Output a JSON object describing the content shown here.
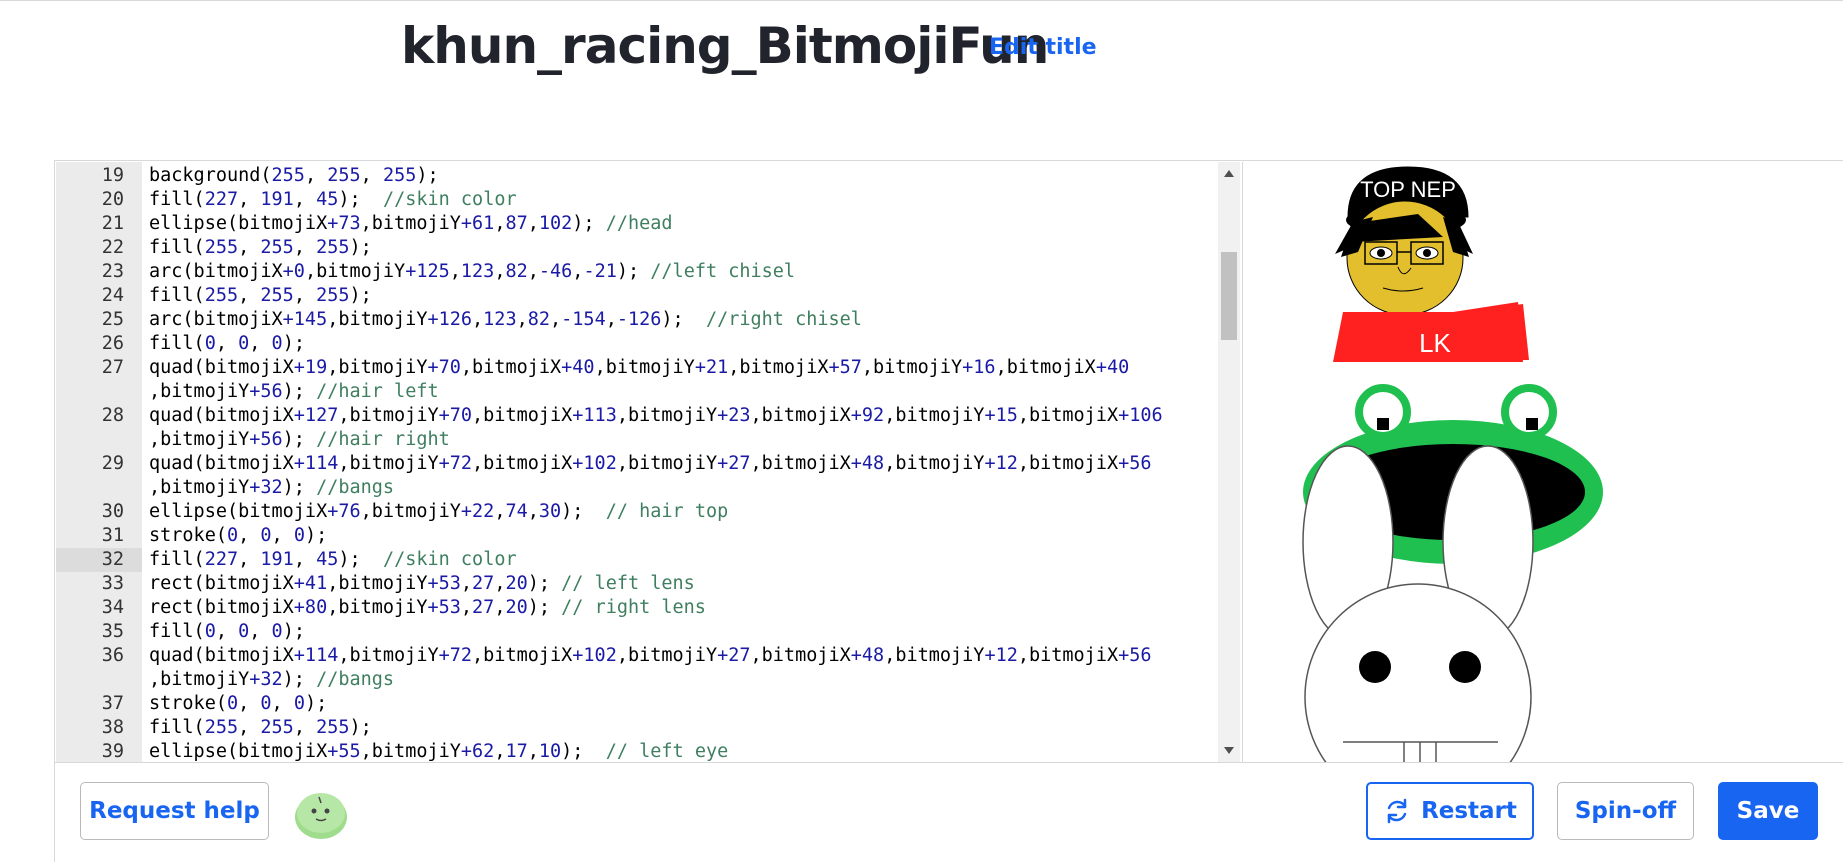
{
  "header": {
    "title": "khun_racing_BitmojiFun",
    "edit_title_label": "Edit title"
  },
  "editor": {
    "active_line": 32,
    "lines": [
      {
        "n": "19",
        "html": "background(<span class='n'>255</span>, <span class='n'>255</span>, <span class='n'>255</span>);"
      },
      {
        "n": "20",
        "html": "fill(<span class='n'>227</span>, <span class='n'>191</span>, <span class='n'>45</span>);  <span class='c'>//skin color</span>"
      },
      {
        "n": "21",
        "html": "ellipse(bitmojiX<span class='n'>+73</span>,bitmojiY<span class='n'>+61</span>,<span class='n'>87</span>,<span class='n'>102</span>); <span class='c'>//head</span>"
      },
      {
        "n": "22",
        "html": "fill(<span class='n'>255</span>, <span class='n'>255</span>, <span class='n'>255</span>);"
      },
      {
        "n": "23",
        "html": "arc(bitmojiX<span class='n'>+0</span>,bitmojiY<span class='n'>+125</span>,<span class='n'>123</span>,<span class='n'>82</span>,<span class='n'>-46</span>,<span class='n'>-21</span>); <span class='c'>//left chisel</span>"
      },
      {
        "n": "24",
        "html": "fill(<span class='n'>255</span>, <span class='n'>255</span>, <span class='n'>255</span>);"
      },
      {
        "n": "25",
        "html": "arc(bitmojiX<span class='n'>+145</span>,bitmojiY<span class='n'>+126</span>,<span class='n'>123</span>,<span class='n'>82</span>,<span class='n'>-154</span>,<span class='n'>-126</span>);  <span class='c'>//right chisel</span>"
      },
      {
        "n": "26",
        "html": "fill(<span class='n'>0</span>, <span class='n'>0</span>, <span class='n'>0</span>);"
      },
      {
        "n": "27",
        "html": "quad(bitmojiX<span class='n'>+19</span>,bitmojiY<span class='n'>+70</span>,bitmojiX<span class='n'>+40</span>,bitmojiY<span class='n'>+21</span>,bitmojiX<span class='n'>+57</span>,bitmojiY<span class='n'>+16</span>,bitmojiX<span class='n'>+40</span>"
      },
      {
        "n": "",
        "html": ",bitmojiY<span class='n'>+56</span>); <span class='c'>//hair left</span>"
      },
      {
        "n": "28",
        "html": "quad(bitmojiX<span class='n'>+127</span>,bitmojiY<span class='n'>+70</span>,bitmojiX<span class='n'>+113</span>,bitmojiY<span class='n'>+23</span>,bitmojiX<span class='n'>+92</span>,bitmojiY<span class='n'>+15</span>,bitmojiX<span class='n'>+106</span>"
      },
      {
        "n": "",
        "html": ",bitmojiY<span class='n'>+56</span>); <span class='c'>//hair right</span>"
      },
      {
        "n": "29",
        "html": "quad(bitmojiX<span class='n'>+114</span>,bitmojiY<span class='n'>+72</span>,bitmojiX<span class='n'>+102</span>,bitmojiY<span class='n'>+27</span>,bitmojiX<span class='n'>+48</span>,bitmojiY<span class='n'>+12</span>,bitmojiX<span class='n'>+56</span>"
      },
      {
        "n": "",
        "html": ",bitmojiY<span class='n'>+32</span>); <span class='c'>//bangs</span>"
      },
      {
        "n": "30",
        "html": "ellipse(bitmojiX<span class='n'>+76</span>,bitmojiY<span class='n'>+22</span>,<span class='n'>74</span>,<span class='n'>30</span>);  <span class='c'>// hair top</span>"
      },
      {
        "n": "31",
        "html": "stroke(<span class='n'>0</span>, <span class='n'>0</span>, <span class='n'>0</span>);"
      },
      {
        "n": "32",
        "html": "fill(<span class='n'>227</span>, <span class='n'>191</span>, <span class='n'>45</span>);  <span class='c'>//skin color</span>"
      },
      {
        "n": "33",
        "html": "rect(bitmojiX<span class='n'>+41</span>,bitmojiY<span class='n'>+53</span>,<span class='n'>27</span>,<span class='n'>20</span>); <span class='c'>// left lens</span>"
      },
      {
        "n": "34",
        "html": "rect(bitmojiX<span class='n'>+80</span>,bitmojiY<span class='n'>+53</span>,<span class='n'>27</span>,<span class='n'>20</span>); <span class='c'>// right lens</span>"
      },
      {
        "n": "35",
        "html": "fill(<span class='n'>0</span>, <span class='n'>0</span>, <span class='n'>0</span>);"
      },
      {
        "n": "36",
        "html": "quad(bitmojiX<span class='n'>+114</span>,bitmojiY<span class='n'>+72</span>,bitmojiX<span class='n'>+102</span>,bitmojiY<span class='n'>+27</span>,bitmojiX<span class='n'>+48</span>,bitmojiY<span class='n'>+12</span>,bitmojiX<span class='n'>+56</span>"
      },
      {
        "n": "",
        "html": ",bitmojiY<span class='n'>+32</span>); <span class='c'>//bangs</span>"
      },
      {
        "n": "37",
        "html": "stroke(<span class='n'>0</span>, <span class='n'>0</span>, <span class='n'>0</span>);"
      },
      {
        "n": "38",
        "html": "fill(<span class='n'>255</span>, <span class='n'>255</span>, <span class='n'>255</span>);"
      },
      {
        "n": "39",
        "html": "ellipse(bitmojiX<span class='n'>+55</span>,bitmojiY<span class='n'>+62</span>,<span class='n'>17</span>,<span class='n'>10</span>);  <span class='c'>// left eye</span>"
      }
    ]
  },
  "canvas": {
    "hat_text": "TOP NEP",
    "shirt_text": "LK"
  },
  "footer": {
    "help_label": "Request help",
    "restart_label": "Restart",
    "spinoff_label": "Spin-off",
    "save_label": "Save"
  },
  "colors": {
    "accent": "#1865f2",
    "skin": "#e3bf2d",
    "shirt": "#ff2020",
    "frog": "#20c050"
  }
}
